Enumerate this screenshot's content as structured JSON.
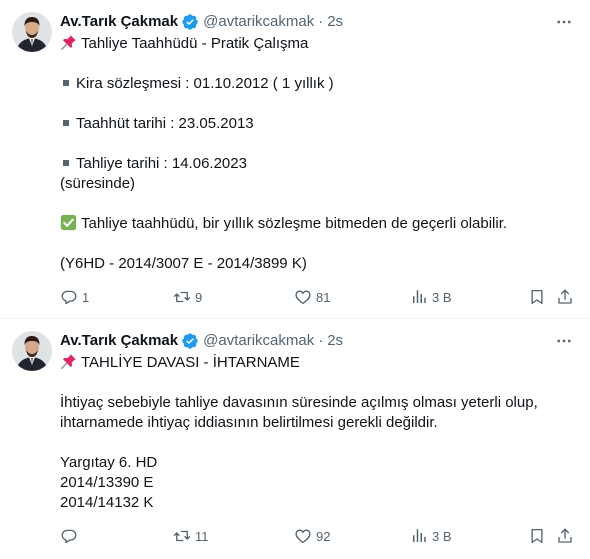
{
  "tweets": [
    {
      "author": {
        "name": "Av.Tarık Çakmak",
        "handle": "@avtarikcakmak",
        "time": "2s"
      },
      "lines": {
        "title": "Tahliye Taahhüdü - Pratik Çalışma",
        "b1": "Kira sözleşmesi : 01.10.2012 ( 1 yıllık )",
        "b2": "Taahhüt tarihi : 23.05.2013",
        "b3": "Tahliye tarihi : 14.06.2023",
        "note": "(süresinde)",
        "check": "Tahliye taahhüdü, bir yıllık sözleşme bitmeden de geçerli olabilir.",
        "ref": "(Y6HD - 2014/3007 E - 2014/3899 K)"
      },
      "stats": {
        "replies": "1",
        "retweets": "9",
        "likes": "81",
        "views": "3 B"
      }
    },
    {
      "author": {
        "name": "Av.Tarık Çakmak",
        "handle": "@avtarikcakmak",
        "time": "2s"
      },
      "lines": {
        "title": "TAHLİYE DAVASI - İHTARNAME",
        "p1": "İhtiyaç sebebiyle tahliye davasının süresinde açılmış olması yeterli olup,",
        "p2": "ihtarnamede ihtiyaç iddiasının belirtilmesi gerekli değildir.",
        "c1": "Yargıtay 6. HD",
        "c2": "2014/13390 E",
        "c3": "2014/14132 K"
      },
      "stats": {
        "replies": "",
        "retweets": "11",
        "likes": "92",
        "views": "3 B"
      }
    }
  ],
  "icons": {
    "pin": "pushpin-icon",
    "check": "check-mark-icon",
    "verified": "verified-badge-icon",
    "more": "more-icon",
    "reply": "reply-icon",
    "retweet": "retweet-icon",
    "like": "like-icon",
    "views": "views-icon",
    "bookmark": "bookmark-icon",
    "share": "share-icon"
  },
  "colors": {
    "text": "#0f1419",
    "muted": "#536471",
    "verified": "#1d9bf0",
    "divider": "#eff3f4"
  }
}
